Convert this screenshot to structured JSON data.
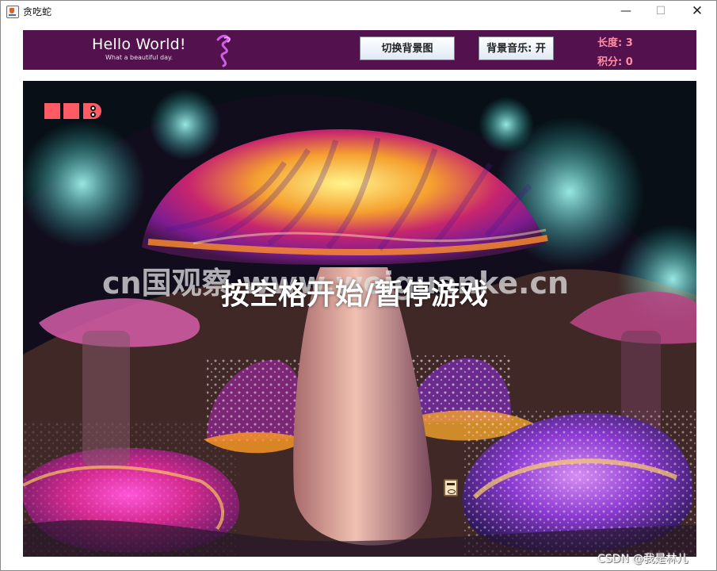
{
  "window": {
    "title": "贪吃蛇",
    "controls": {
      "minimize": "—",
      "maximize": "☐",
      "close": "✕"
    }
  },
  "header": {
    "hello": "Hello World!",
    "subtitle": "What a beautiful day.",
    "background_button": "切换背景图",
    "music_button": "背景音乐: 开",
    "length_label": "长度: 3",
    "score_label": "积分: 0"
  },
  "game": {
    "watermark": "cn国观察 www.weiguanke.cn",
    "start_prompt": "按空格开始/暂停游戏",
    "snake_length": 3,
    "score": 0,
    "background_image_icon": "mushroom-background-image",
    "food_icon": "food-icon"
  },
  "footer": {
    "attribution": "CSDN @我是林儿"
  },
  "colors": {
    "header": "#53114e",
    "snake": "#ff5b64",
    "stats": "#ff8da3"
  }
}
